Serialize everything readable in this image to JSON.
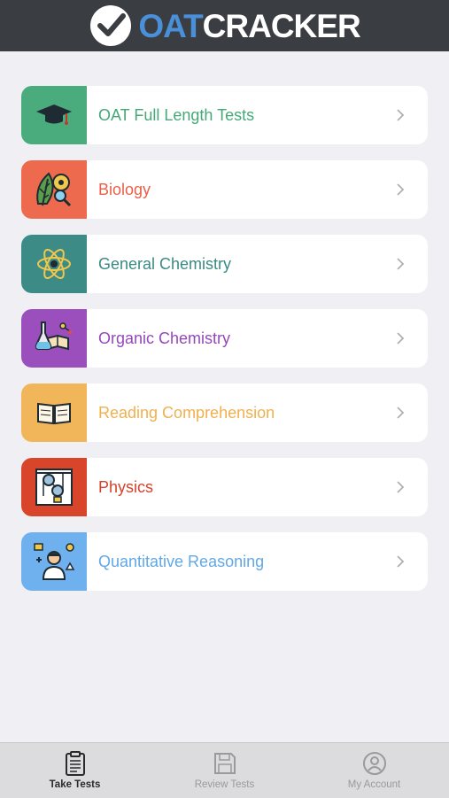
{
  "header": {
    "logo_icon": "checkmark-circle-icon",
    "logo_oat": "OAT",
    "logo_cracker": "CRACKER",
    "logo_oat_color": "#4a90d9"
  },
  "subjects": [
    {
      "label": "OAT Full Length Tests",
      "icon": "graduation-cap-icon",
      "icon_bg": "#4aab7c",
      "text_color": "#45a877"
    },
    {
      "label": "Biology",
      "icon": "leaf-microscope-icon",
      "icon_bg": "#ee6a4e",
      "text_color": "#e8604a"
    },
    {
      "label": "General Chemistry",
      "icon": "atom-icon",
      "icon_bg": "#3d8b87",
      "text_color": "#3a8a84"
    },
    {
      "label": "Organic Chemistry",
      "icon": "flask-book-icon",
      "icon_bg": "#9a4fbd",
      "text_color": "#9448bb"
    },
    {
      "label": "Reading Comprehension",
      "icon": "open-book-icon",
      "icon_bg": "#f1b659",
      "text_color": "#f0b04f"
    },
    {
      "label": "Physics",
      "icon": "pulley-icon",
      "icon_bg": "#d9452b",
      "text_color": "#d2432c"
    },
    {
      "label": "Quantitative Reasoning",
      "icon": "person-math-icon",
      "icon_bg": "#6fb1ee",
      "text_color": "#62a8e6"
    }
  ],
  "tabbar": {
    "tabs": [
      {
        "label": "Take Tests",
        "icon": "clipboard-icon",
        "active": true
      },
      {
        "label": "Review Tests",
        "icon": "floppy-disk-icon",
        "active": false
      },
      {
        "label": "My Account",
        "icon": "user-circle-icon",
        "active": false
      }
    ]
  }
}
